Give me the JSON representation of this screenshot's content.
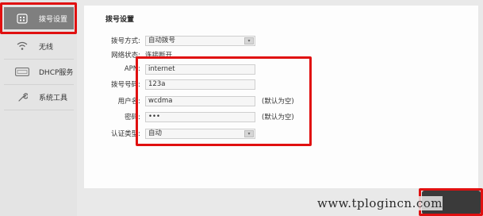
{
  "sidebar": {
    "items": [
      {
        "label": "拨号设置",
        "icon": "dial-settings-icon",
        "active": true
      },
      {
        "label": "无线",
        "icon": "wifi-icon",
        "active": false
      },
      {
        "label": "DHCP服务",
        "icon": "dhcp-icon",
        "active": false
      },
      {
        "label": "系统工具",
        "icon": "wrench-icon",
        "active": false
      }
    ]
  },
  "main": {
    "title": "拨号设置",
    "dial_mode": {
      "label": "拨号方式:",
      "value": "自动拨号"
    },
    "network_status": {
      "label": "网络状态:",
      "value": "连接断开"
    },
    "apn": {
      "label": "APN:",
      "value": "internet"
    },
    "dial_number": {
      "label": "拨号号码:",
      "value": "123a"
    },
    "username": {
      "label": "用户名:",
      "value": "wcdma",
      "hint": "(默认为空)"
    },
    "password": {
      "label": "密码:",
      "value": "•••",
      "hint": "(默认为空)"
    },
    "auth_type": {
      "label": "认证类型:",
      "value": "自动"
    }
  },
  "watermark": "www.tplogincn.com",
  "colors": {
    "highlight": "#e01010",
    "active_item": "#7f7f7f"
  }
}
